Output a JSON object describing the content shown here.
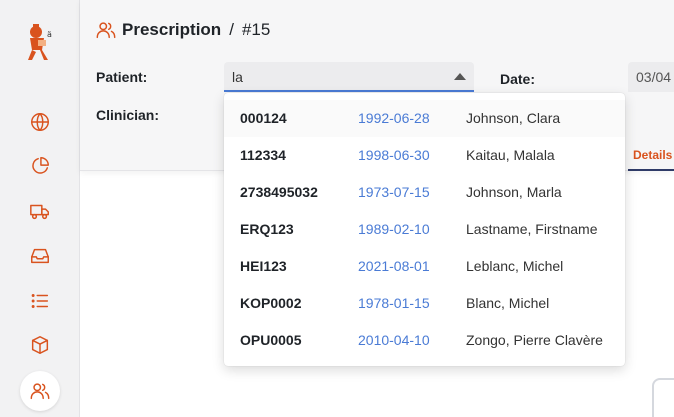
{
  "nav": {
    "items": [
      {
        "icon": "globe-icon"
      },
      {
        "icon": "pie-chart-icon"
      },
      {
        "icon": "truck-icon"
      },
      {
        "icon": "inbox-icon"
      },
      {
        "icon": "list-icon"
      },
      {
        "icon": "package-icon"
      },
      {
        "icon": "users-icon",
        "active": true
      }
    ]
  },
  "header": {
    "title": "Prescription",
    "separator": "/",
    "number": "#15"
  },
  "form": {
    "patient_label": "Patient:",
    "patient_value": "la",
    "clinician_label": "Clinician:",
    "date_label": "Date:",
    "date_value": "03/04",
    "details_tab": "Details"
  },
  "dropdown": {
    "options": [
      {
        "code": "000124",
        "dob": "1992-06-28",
        "name": "Johnson, Clara"
      },
      {
        "code": "112334",
        "dob": "1998-06-30",
        "name": "Kaitau, Malala"
      },
      {
        "code": "2738495032",
        "dob": "1973-07-15",
        "name": "Johnson, Marla"
      },
      {
        "code": "ERQ123",
        "dob": "1989-02-10",
        "name": "Lastname, Firstname"
      },
      {
        "code": "HEI123",
        "dob": "2021-08-01",
        "name": "Leblanc, Michel"
      },
      {
        "code": "KOP0002",
        "dob": "1978-01-15",
        "name": "Blanc, Michel"
      },
      {
        "code": "OPU0005",
        "dob": "2010-04-10",
        "name": "Zongo, Pierre Clavère"
      }
    ]
  },
  "colors": {
    "accent": "#d9531e",
    "link": "#4a7bd5",
    "tab_underline": "#2f3b68"
  }
}
